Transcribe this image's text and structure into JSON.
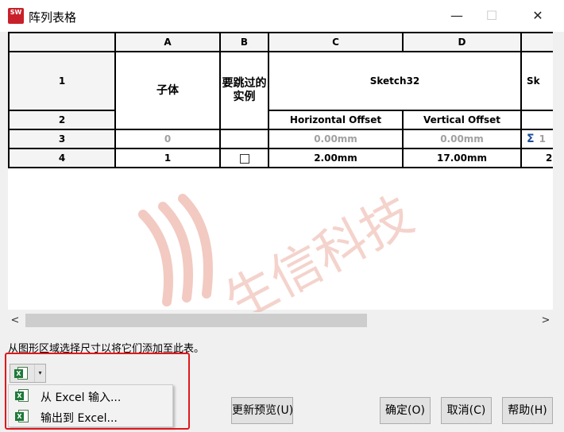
{
  "window": {
    "app_icon_text": "SW",
    "title": "阵列表格",
    "minimize_glyph": "—",
    "maximize_glyph": "☐",
    "close_glyph": "✕"
  },
  "table": {
    "columns": [
      "A",
      "B",
      "C",
      "D",
      ""
    ],
    "rows": {
      "r1": {
        "num": "1",
        "a": "子体",
        "b": "要跳过的实例",
        "cd": "Sketch32",
        "e": "Sk"
      },
      "r2": {
        "num": "2",
        "c": "Horizontal Offset",
        "d": "Vertical Offset",
        "e": ""
      },
      "r3": {
        "num": "3",
        "a": "0",
        "c": "0.00mm",
        "d": "0.00mm",
        "e": "1"
      },
      "r4": {
        "num": "4",
        "a": "1",
        "b_checked": false,
        "c": "2.00mm",
        "d": "17.00mm",
        "e": "2"
      }
    }
  },
  "scrollbar": {
    "left_glyph": "<",
    "right_glyph": ">"
  },
  "hint_text": "从图形区域选择尺寸以将它们添加至此表。",
  "excel_button": {
    "icon": "excel-icon",
    "dropdown_glyph": "▾"
  },
  "menu": {
    "items": [
      {
        "label": "从 Excel 输入...",
        "icon": "excel-import-icon"
      },
      {
        "label": "输出到 Excel...",
        "icon": "excel-export-icon"
      }
    ]
  },
  "buttons": {
    "update_preview": "更新预览(U)",
    "ok": "确定(O)",
    "cancel": "取消(C)",
    "help": "帮助(H)"
  },
  "watermark": {
    "text": "生信科技",
    "color": "#e8a090"
  },
  "colors": {
    "highlight": "#e0181b",
    "excel_green": "#1f7a3a",
    "sigma_blue": "#1a4e9a"
  }
}
